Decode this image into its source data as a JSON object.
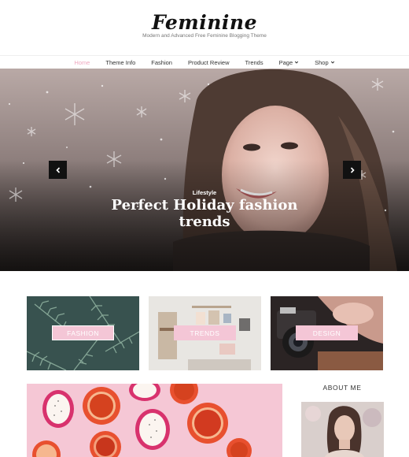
{
  "header": {
    "logo": "Feminine",
    "tagline": "Modern and Advanced Free Feminine Blogging Theme"
  },
  "nav": {
    "items": [
      {
        "label": "Home",
        "active": true,
        "dropdown": false
      },
      {
        "label": "Theme Info",
        "active": false,
        "dropdown": false
      },
      {
        "label": "Fashion",
        "active": false,
        "dropdown": false
      },
      {
        "label": "Product Review",
        "active": false,
        "dropdown": false
      },
      {
        "label": "Trends",
        "active": false,
        "dropdown": false
      },
      {
        "label": "Page",
        "active": false,
        "dropdown": true
      },
      {
        "label": "Shop",
        "active": false,
        "dropdown": true
      }
    ],
    "active_color": "#f0a8c0"
  },
  "hero": {
    "category": "Lifestyle",
    "title": "Perfect Holiday fashion trends",
    "prev_icon": "chevron-left-icon",
    "next_icon": "chevron-right-icon"
  },
  "categories": [
    {
      "label": "FASHION"
    },
    {
      "label": "TRENDS"
    },
    {
      "label": "DESIGN"
    }
  ],
  "sidebar": {
    "about_title": "ABOUT ME"
  },
  "colors": {
    "accent_pink": "#f4c6d6",
    "arrow_bg": "#111111"
  }
}
